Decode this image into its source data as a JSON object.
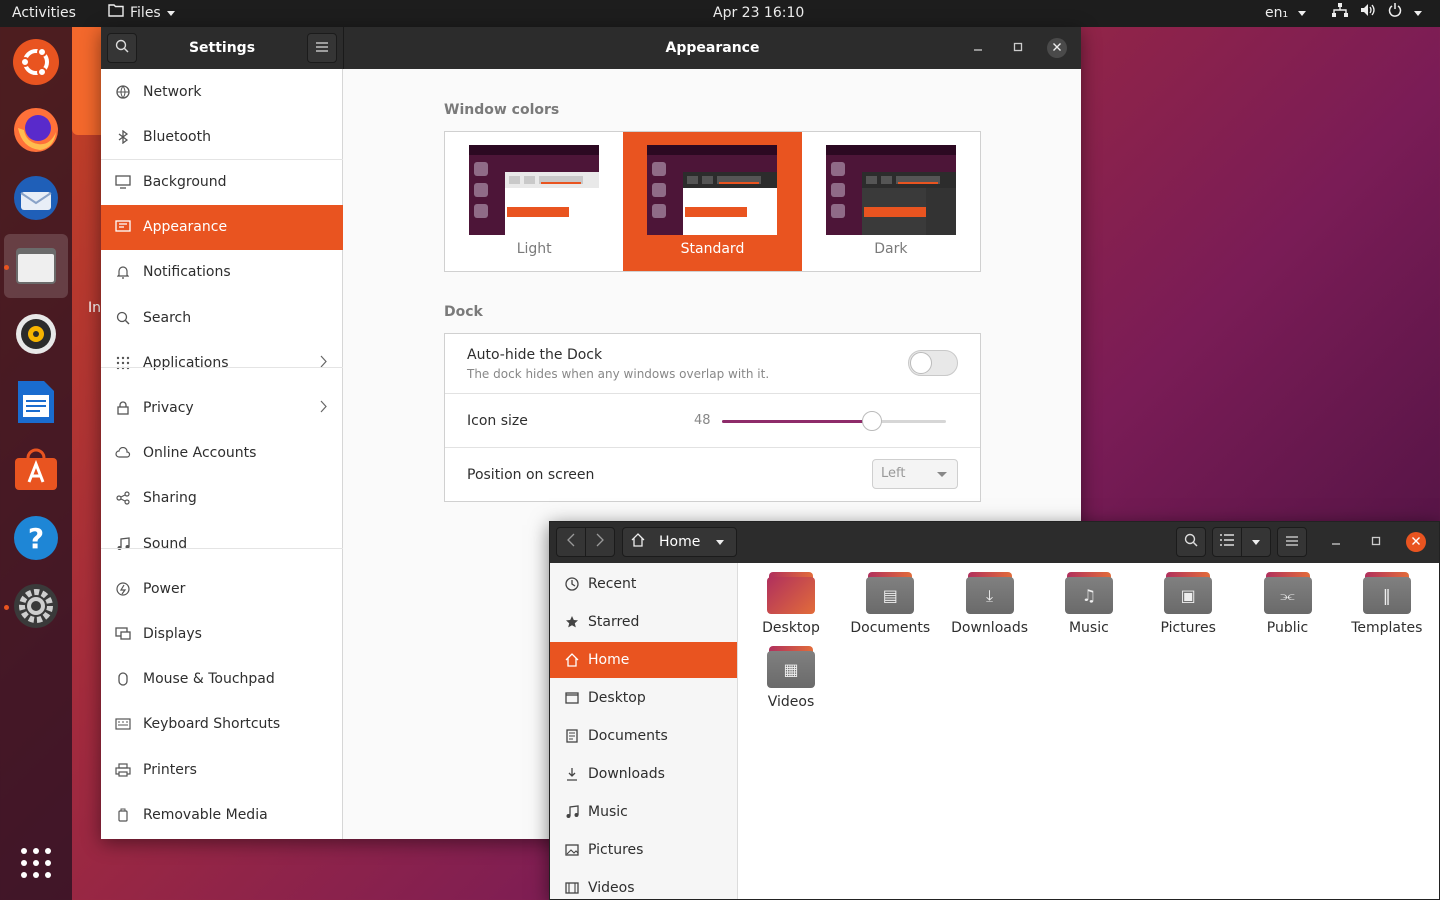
{
  "topbar": {
    "activities": "Activities",
    "app_menu": "Files",
    "clock": "Apr 23  16:10",
    "language": "en₁"
  },
  "dock": {
    "items": [
      "ubuntu-logo-icon",
      "firefox-icon",
      "thunderbird-icon",
      "files-icon",
      "rhythmbox-icon",
      "writer-icon",
      "software-icon",
      "help-icon",
      "settings-icon"
    ],
    "show_apps": "grid-icon"
  },
  "background_window_text": "In",
  "settings": {
    "title": "Settings",
    "panel_title": "Appearance",
    "sidebar": [
      {
        "label": "Network",
        "icon": "globe-icon"
      },
      {
        "label": "Bluetooth",
        "icon": "bluetooth-icon"
      },
      {
        "label": "Background",
        "icon": "monitor-icon"
      },
      {
        "label": "Appearance",
        "icon": "appearance-icon",
        "selected": true
      },
      {
        "label": "Notifications",
        "icon": "bell-icon"
      },
      {
        "label": "Search",
        "icon": "search-icon"
      },
      {
        "label": "Applications",
        "icon": "apps-icon",
        "has_children": true
      },
      {
        "label": "Privacy",
        "icon": "lock-icon",
        "has_children": true
      },
      {
        "label": "Online Accounts",
        "icon": "cloud-icon"
      },
      {
        "label": "Sharing",
        "icon": "share-icon"
      },
      {
        "label": "Sound",
        "icon": "music-note-icon"
      },
      {
        "label": "Power",
        "icon": "power-icon"
      },
      {
        "label": "Displays",
        "icon": "display-icon"
      },
      {
        "label": "Mouse & Touchpad",
        "icon": "mouse-icon"
      },
      {
        "label": "Keyboard Shortcuts",
        "icon": "keyboard-icon"
      },
      {
        "label": "Printers",
        "icon": "printer-icon"
      },
      {
        "label": "Removable Media",
        "icon": "usb-icon"
      }
    ],
    "window_colors": {
      "title": "Window colors",
      "options": [
        {
          "label": "Light"
        },
        {
          "label": "Standard",
          "selected": true
        },
        {
          "label": "Dark"
        }
      ]
    },
    "dock": {
      "title": "Dock",
      "autohide_title": "Auto-hide the Dock",
      "autohide_subtitle": "The dock hides when any windows overlap with it.",
      "autohide_enabled": false,
      "icon_size_label": "Icon size",
      "icon_size_value": "48",
      "icon_size_fraction": 0.67,
      "position_label": "Position on screen",
      "position_value": "Left"
    }
  },
  "files": {
    "path": "Home",
    "sidebar": [
      {
        "label": "Recent",
        "icon": "clock-icon"
      },
      {
        "label": "Starred",
        "icon": "star-icon"
      },
      {
        "label": "Home",
        "icon": "home-icon",
        "selected": true
      },
      {
        "label": "Desktop",
        "icon": "desktop-icon"
      },
      {
        "label": "Documents",
        "icon": "document-icon"
      },
      {
        "label": "Downloads",
        "icon": "download-icon"
      },
      {
        "label": "Music",
        "icon": "music-icon"
      },
      {
        "label": "Pictures",
        "icon": "picture-icon"
      },
      {
        "label": "Videos",
        "icon": "video-icon"
      }
    ],
    "folders": [
      {
        "label": "Desktop",
        "icon": "desktop-folder-icon"
      },
      {
        "label": "Documents",
        "icon": "documents-folder-icon"
      },
      {
        "label": "Downloads",
        "icon": "downloads-folder-icon"
      },
      {
        "label": "Music",
        "icon": "music-folder-icon"
      },
      {
        "label": "Pictures",
        "icon": "pictures-folder-icon"
      },
      {
        "label": "Public",
        "icon": "public-folder-icon"
      },
      {
        "label": "Templates",
        "icon": "templates-folder-icon"
      },
      {
        "label": "Videos",
        "icon": "videos-folder-icon"
      }
    ]
  },
  "colors": {
    "accent": "#e95420",
    "slider": "#8e2b6a",
    "header": "#2c2c2c"
  }
}
